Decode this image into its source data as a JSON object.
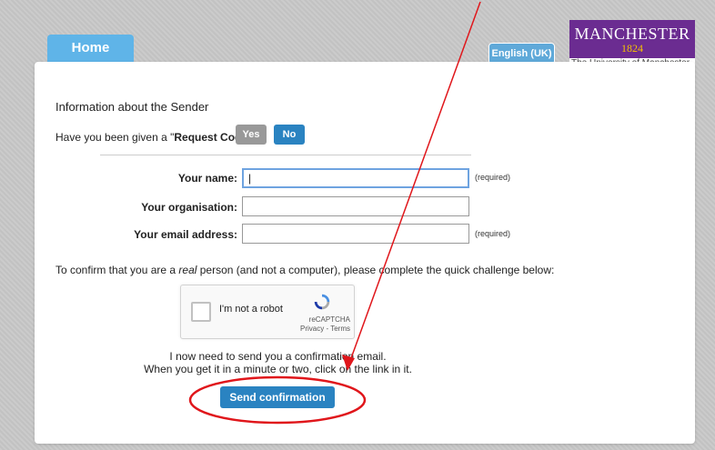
{
  "nav": {
    "home_label": "Home"
  },
  "language": {
    "label": "English (UK)"
  },
  "logo": {
    "name": "MANCHESTER",
    "year": "1824",
    "tagline": "The University of Manchester"
  },
  "form": {
    "section_title": "Information about the Sender",
    "request_question_prefix": "Have you been given a \"",
    "request_question_bold": "Request Code",
    "request_question_suffix": "\"?",
    "yes_label": "Yes",
    "no_label": "No",
    "fields": [
      {
        "label": "Your name:",
        "value": "|",
        "required": "(required)"
      },
      {
        "label": "Your organisation:",
        "value": "",
        "required": ""
      },
      {
        "label": "Your email address:",
        "value": "",
        "required": "(required)"
      }
    ],
    "confirm_prefix": "To confirm that you are a ",
    "confirm_italic": "real",
    "confirm_suffix": " person (and not a computer), please complete the quick challenge below:"
  },
  "captcha": {
    "label": "I'm not a robot",
    "brand": "reCAPTCHA",
    "terms": "Privacy - Terms"
  },
  "info": {
    "line1": "I now need to send you a confirmation email.",
    "line2": "When you get it in a minute or two, click on the link in it."
  },
  "send_button": {
    "label": "Send confirmation"
  },
  "colors": {
    "accent": "#2a83c1",
    "tab": "#5fb4e8",
    "brand": "#6b2c91",
    "annotation": "#e0161b"
  },
  "icons": [
    "recaptcha-icon"
  ]
}
